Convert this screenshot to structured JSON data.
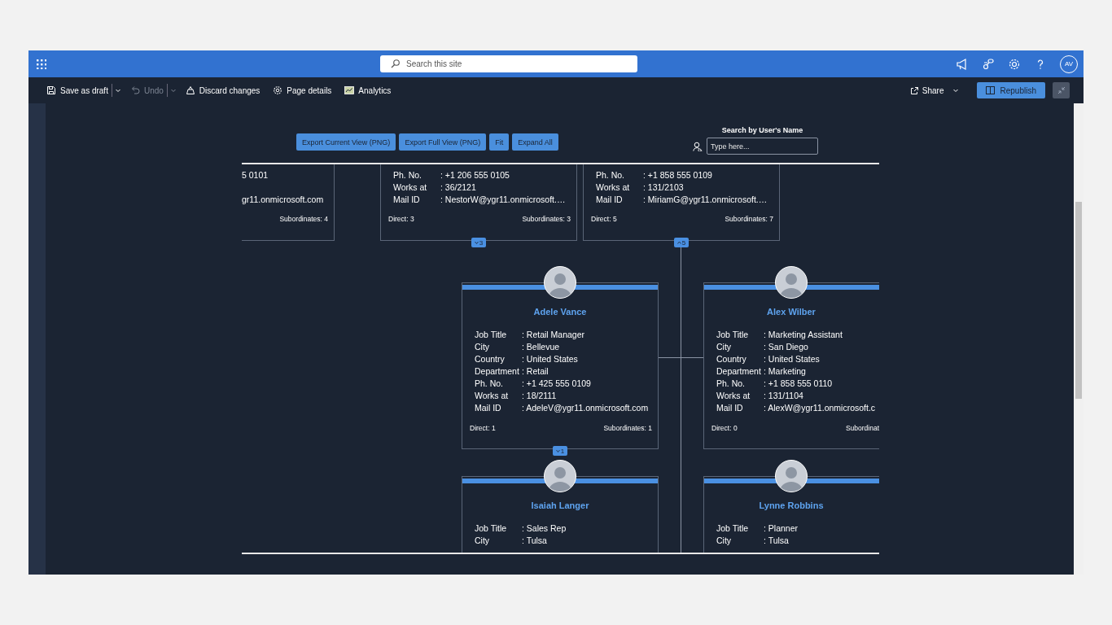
{
  "suite_bar": {
    "search": {
      "placeholder": "Search this site"
    },
    "avatar": {
      "initials": "AV"
    }
  },
  "command_bar": {
    "items": [
      {
        "label": "Save as draft",
        "kind": "split",
        "disabled": false
      },
      {
        "label": "Undo",
        "kind": "split",
        "disabled": true
      },
      {
        "label": "Discard changes",
        "kind": "plain",
        "disabled": false
      },
      {
        "label": "Page details",
        "kind": "plain",
        "disabled": false
      },
      {
        "label": "Analytics",
        "kind": "plain",
        "disabled": false
      }
    ],
    "share": {
      "label": "Share"
    },
    "republish": {
      "label": "Republish"
    }
  },
  "org_chart": {
    "toolbar": [
      "Export Current View (PNG)",
      "Export Full View (PNG)",
      "Fit",
      "Expand All"
    ],
    "search": {
      "label": "Search by User's Name",
      "placeholder": "Type here..."
    },
    "cards": [
      {
        "kind": "left-cut",
        "lines": [
          "5 0101",
          "gr11.onmicrosoft.com"
        ],
        "subordinates": "Subordinates: 4"
      },
      {
        "kind": "top-cut",
        "fields": [
          {
            "label": "Ph. No.",
            "value": ": +1 206 555 0105"
          },
          {
            "label": "Works at",
            "value": ": 36/2121"
          },
          {
            "label": "Mail ID",
            "value": ": NestorW@ygr11.onmicrosoft.…"
          }
        ],
        "direct": "Direct: 3",
        "subordinates": "Subordinates: 3",
        "badge": {
          "count": "3",
          "expanded": false
        }
      },
      {
        "kind": "top-cut",
        "fields": [
          {
            "label": "Ph. No.",
            "value": ": +1 858 555 0109"
          },
          {
            "label": "Works at",
            "value": ": 131/2103"
          },
          {
            "label": "Mail ID",
            "value": ": MiriamG@ygr11.onmicrosoft.…"
          }
        ],
        "direct": "Direct: 5",
        "subordinates": "Subordinates: 7",
        "badge": {
          "count": "5",
          "expanded": true
        }
      },
      {
        "kind": "full",
        "name": "Adele Vance",
        "fields": [
          {
            "label": "Job Title",
            "value": ": Retail Manager"
          },
          {
            "label": "City",
            "value": ": Bellevue"
          },
          {
            "label": "Country",
            "value": ": United States"
          },
          {
            "label": "Department",
            "value": ": Retail"
          },
          {
            "label": "Ph. No.",
            "value": ": +1 425 555 0109"
          },
          {
            "label": "Works at",
            "value": ": 18/2111"
          },
          {
            "label": "Mail ID",
            "value": ": AdeleV@ygr11.onmicrosoft.com"
          }
        ],
        "direct": "Direct: 1",
        "subordinates": "Subordinates: 1",
        "badge": {
          "count": "1",
          "expanded": false
        }
      },
      {
        "kind": "full",
        "name": "Alex Wilber",
        "fields": [
          {
            "label": "Job Title",
            "value": ": Marketing Assistant"
          },
          {
            "label": "City",
            "value": ": San Diego"
          },
          {
            "label": "Country",
            "value": ": United States"
          },
          {
            "label": "Department",
            "value": ": Marketing"
          },
          {
            "label": "Ph. No.",
            "value": ": +1 858 555 0110"
          },
          {
            "label": "Works at",
            "value": ": 131/1104"
          },
          {
            "label": "Mail ID",
            "value": ": AlexW@ygr11.onmicrosoft.c"
          }
        ],
        "direct": "Direct: 0",
        "subordinates": "Subordinat"
      },
      {
        "kind": "full",
        "name": "Isaiah Langer",
        "fields": [
          {
            "label": "Job Title",
            "value": ": Sales Rep"
          },
          {
            "label": "City",
            "value": ": Tulsa"
          }
        ]
      },
      {
        "kind": "full",
        "name": "Lynne Robbins",
        "fields": [
          {
            "label": "Job Title",
            "value": ": Planner"
          },
          {
            "label": "City",
            "value": ": Tulsa"
          }
        ]
      }
    ]
  }
}
